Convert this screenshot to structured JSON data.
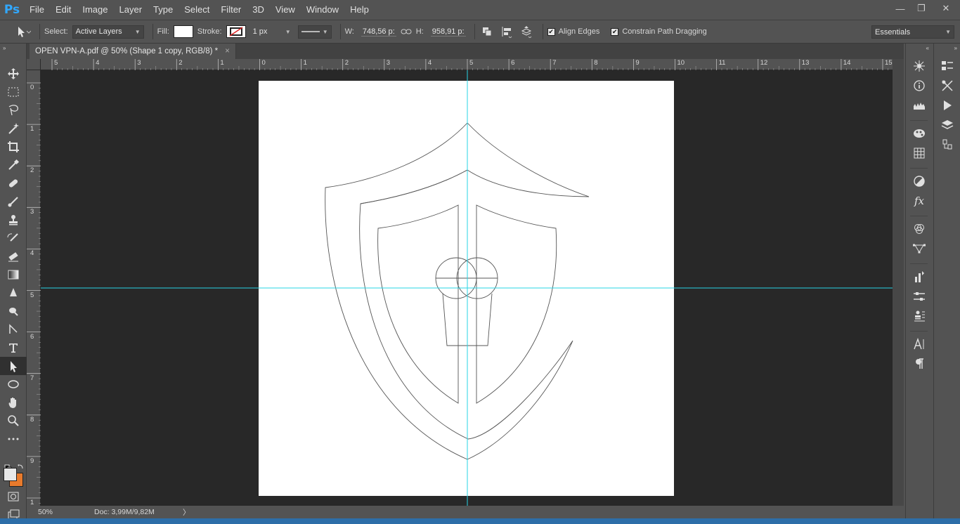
{
  "app": {
    "logo": "Ps"
  },
  "menu": [
    "File",
    "Edit",
    "Image",
    "Layer",
    "Type",
    "Select",
    "Filter",
    "3D",
    "View",
    "Window",
    "Help"
  ],
  "window_controls": {
    "minimize": "—",
    "restore": "❐",
    "close": "✕"
  },
  "options": {
    "select_label": "Select:",
    "select_value": "Active Layers",
    "fill_label": "Fill:",
    "stroke_label": "Stroke:",
    "stroke_width": "1 px",
    "w_label": "W:",
    "w_value": "748,56 p:",
    "h_label": "H:",
    "h_value": "958,91 p:",
    "align_edges": "Align Edges",
    "constrain": "Constrain Path Dragging",
    "workspace": "Essentials"
  },
  "document": {
    "tab_title": "OPEN VPN-A.pdf @ 50% (Shape 1 copy, RGB/8) *",
    "tab_close": "×",
    "ruler_h": [
      "5",
      "4",
      "3",
      "2",
      "1",
      "0",
      "1",
      "2",
      "3",
      "4",
      "5",
      "6",
      "7",
      "8",
      "9",
      "10",
      "11",
      "12",
      "13",
      "14",
      "15"
    ],
    "ruler_v": [
      "0",
      "1",
      "2",
      "3",
      "4",
      "5",
      "6",
      "7",
      "8",
      "9",
      "1"
    ]
  },
  "status": {
    "zoom": "50%",
    "doc": "Doc: 3,99M/9,82M",
    "arrow": "〉"
  },
  "colors": {
    "accent": "#31a8ff",
    "guide": "#27d4e6",
    "foreground": "#e8e8e8",
    "background": "#e87a2c"
  }
}
